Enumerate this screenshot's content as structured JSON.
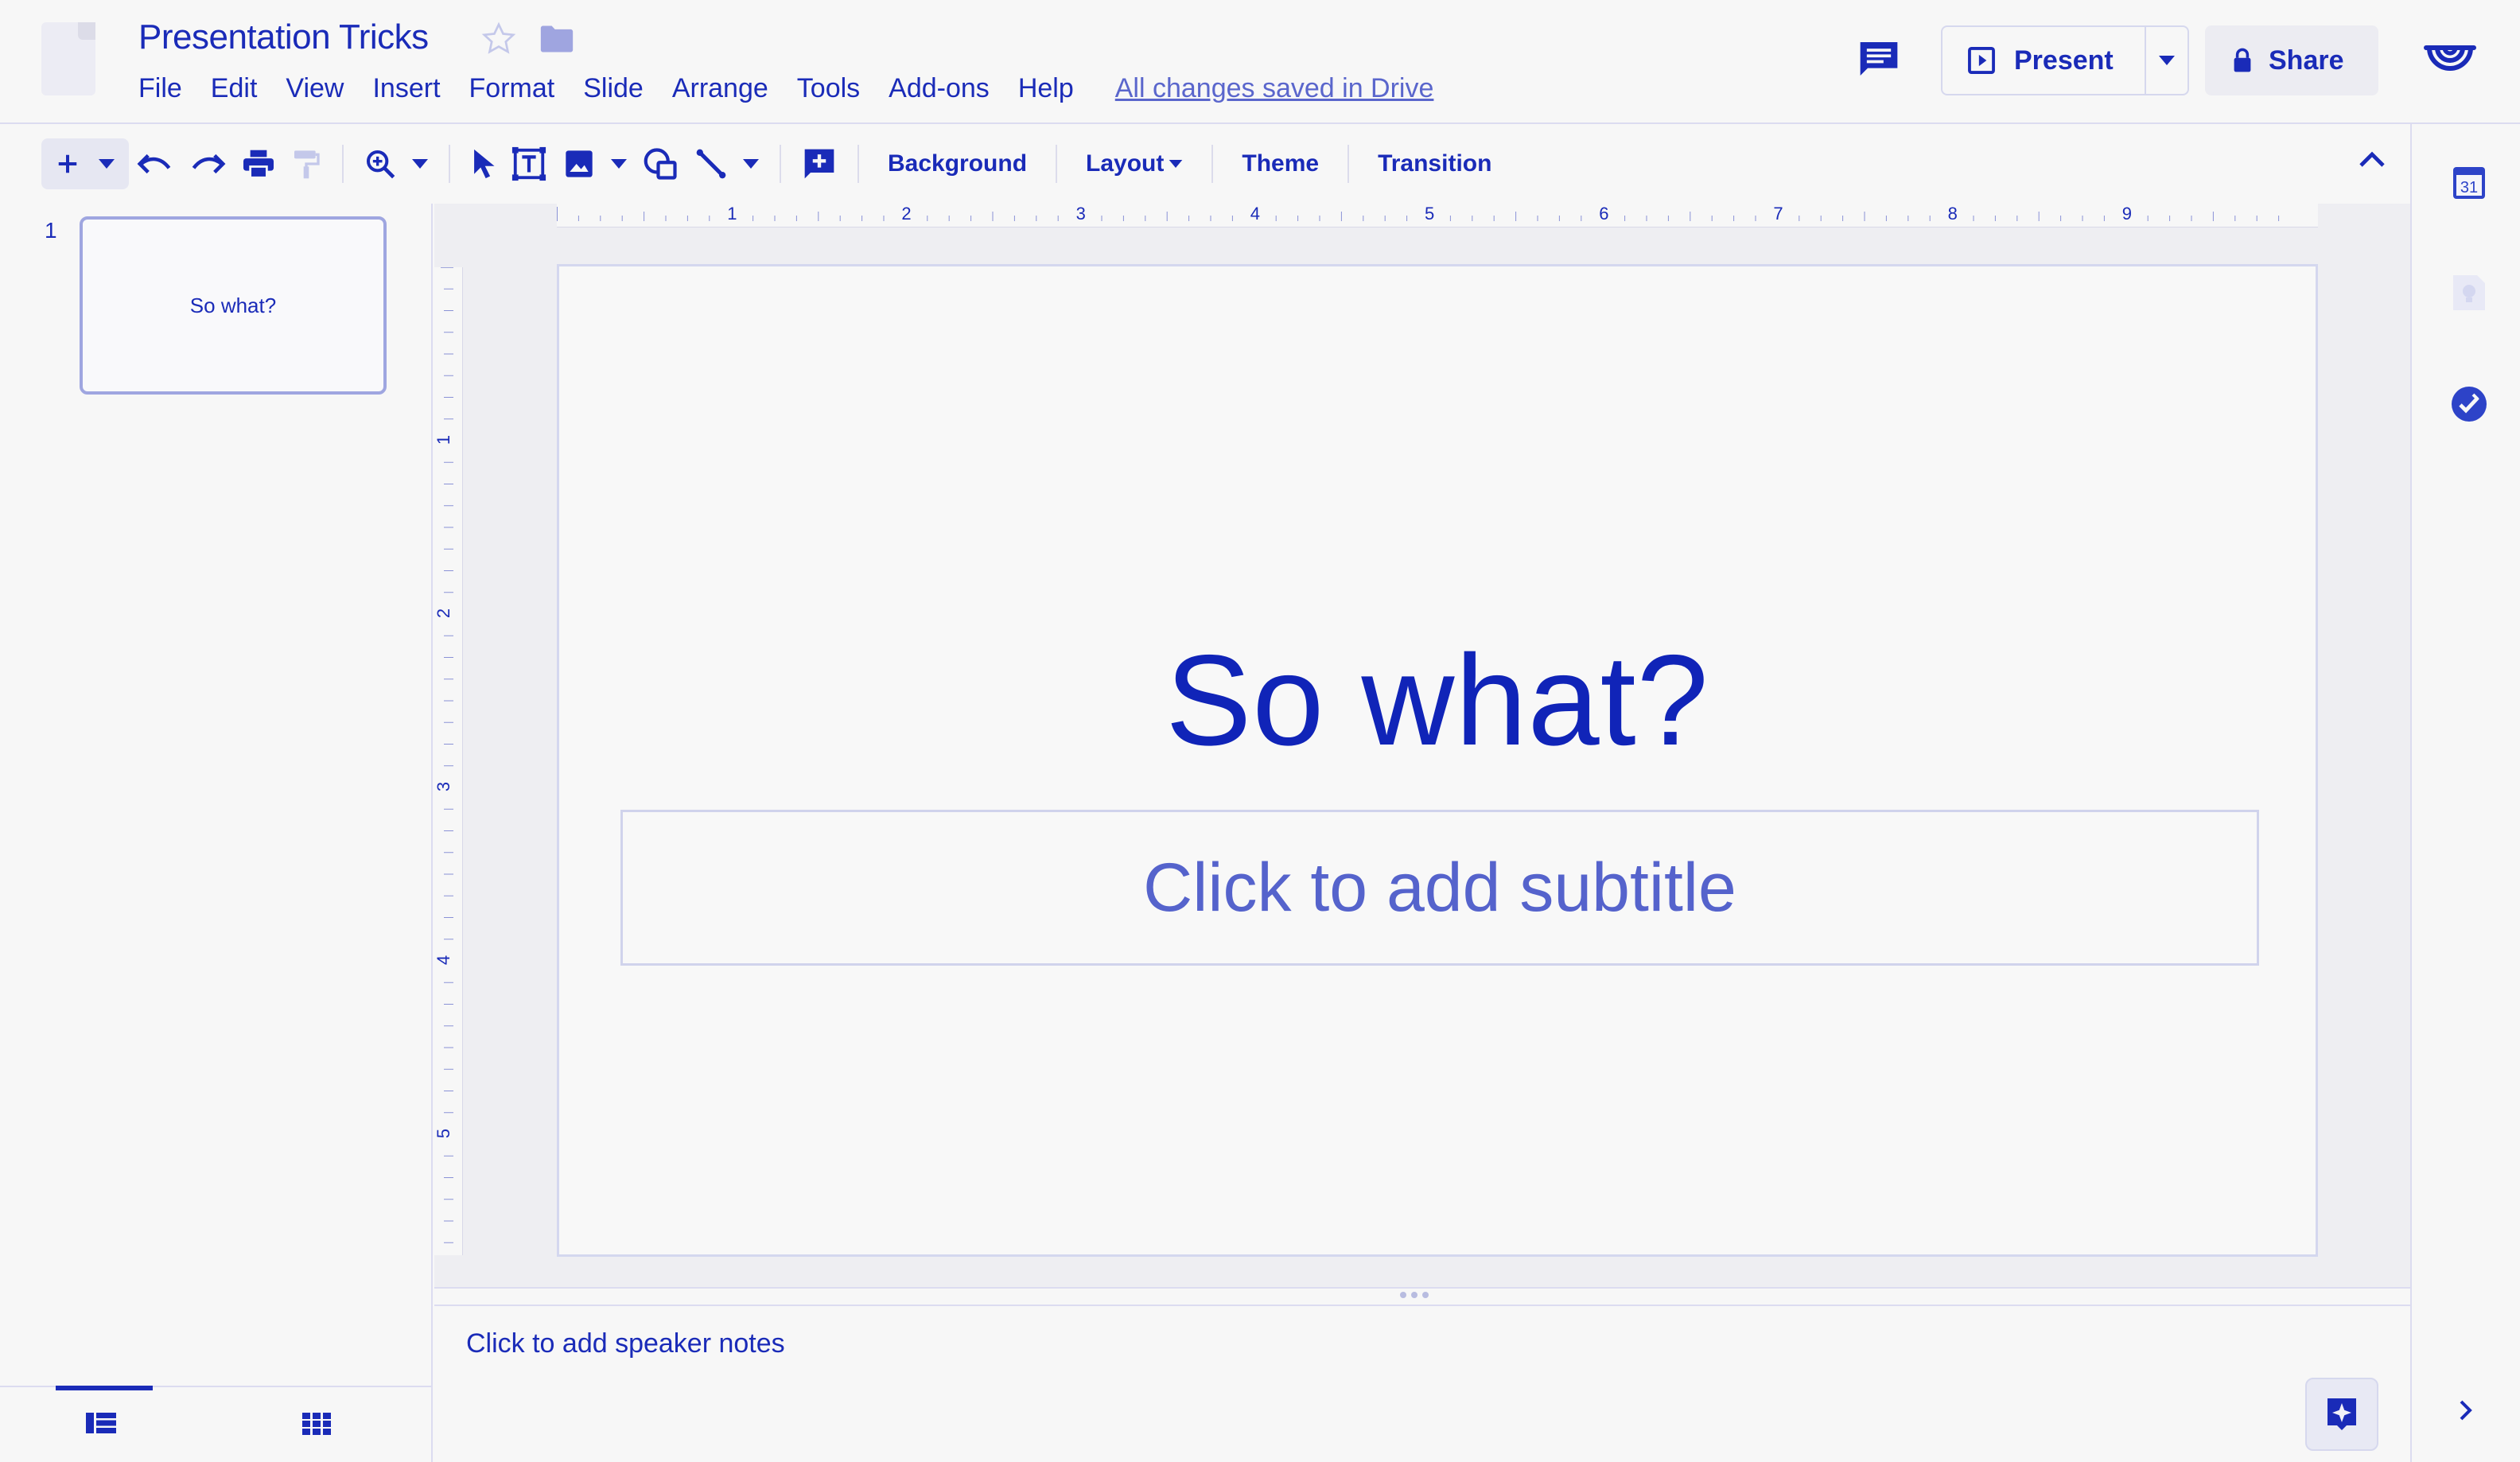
{
  "header": {
    "title": "Presentation Tricks",
    "menu": [
      "File",
      "Edit",
      "View",
      "Insert",
      "Format",
      "Slide",
      "Arrange",
      "Tools",
      "Add-ons",
      "Help"
    ],
    "save_status": "All changes saved in Drive",
    "present_label": "Present",
    "share_label": "Share"
  },
  "toolbar": {
    "background_label": "Background",
    "layout_label": "Layout",
    "theme_label": "Theme",
    "transition_label": "Transition"
  },
  "rulers": {
    "top_ticks": [
      "1",
      "2",
      "3",
      "4",
      "5",
      "6",
      "7",
      "8",
      "9"
    ],
    "left_ticks": [
      "1",
      "2",
      "3",
      "4",
      "5"
    ]
  },
  "filmstrip": {
    "slides": [
      {
        "number": "1",
        "title": "So what?"
      }
    ]
  },
  "slide": {
    "title": "So what?",
    "subtitle_placeholder": "Click to add subtitle"
  },
  "notes": {
    "placeholder": "Click to add speaker notes"
  },
  "side_panel": {
    "calendar_day": "31"
  },
  "icons": {
    "accent": "#1a2bb8",
    "muted": "#b8bce6"
  }
}
